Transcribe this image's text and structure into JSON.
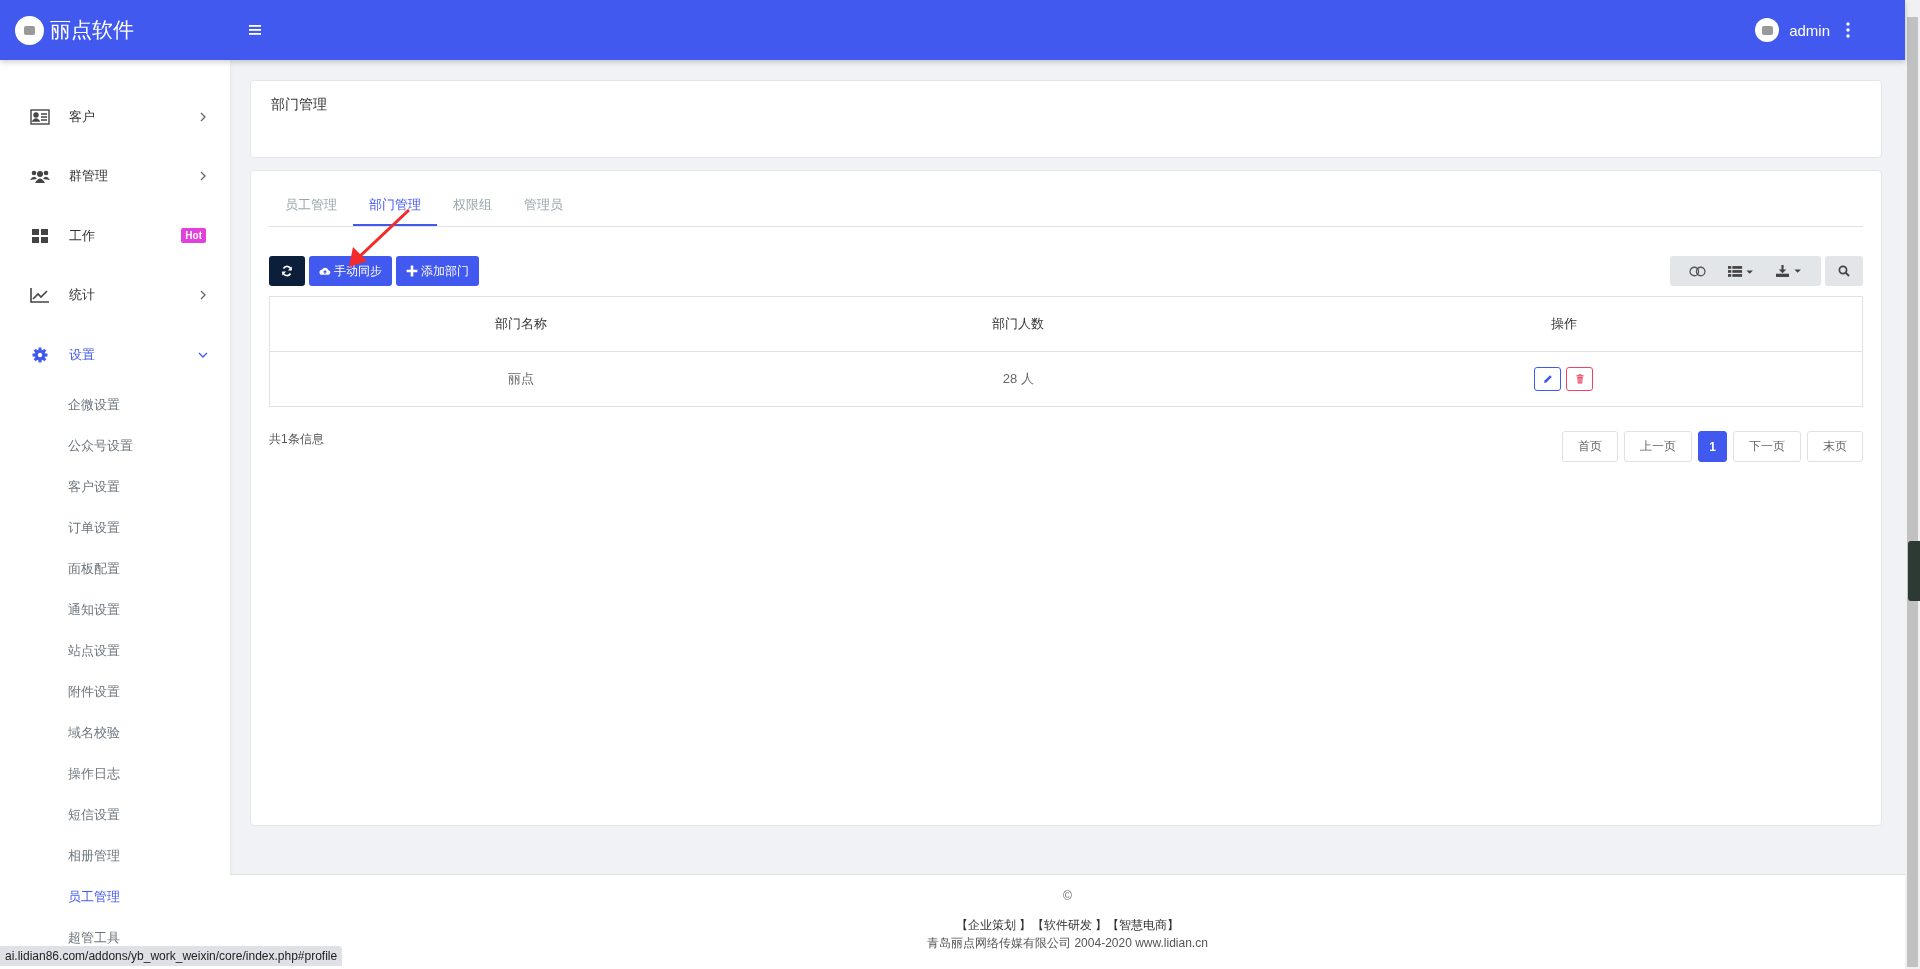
{
  "brand": {
    "name": "丽点软件"
  },
  "user": {
    "name": "admin"
  },
  "sidebar": {
    "items": [
      {
        "label": "客户",
        "kind": "submenu",
        "selected": false,
        "expanded": false
      },
      {
        "label": "群管理",
        "kind": "submenu",
        "selected": false,
        "expanded": false
      },
      {
        "label": "工作",
        "kind": "badge",
        "badge": "Hot",
        "selected": false
      },
      {
        "label": "统计",
        "kind": "submenu",
        "selected": false,
        "expanded": false
      },
      {
        "label": "设置",
        "kind": "submenu",
        "selected": true,
        "expanded": true,
        "children": [
          {
            "label": "企微设置",
            "selected": false
          },
          {
            "label": "公众号设置",
            "selected": false
          },
          {
            "label": "客户设置",
            "selected": false
          },
          {
            "label": "订单设置",
            "selected": false
          },
          {
            "label": "面板配置",
            "selected": false
          },
          {
            "label": "通知设置",
            "selected": false
          },
          {
            "label": "站点设置",
            "selected": false
          },
          {
            "label": "附件设置",
            "selected": false
          },
          {
            "label": "域名校验",
            "selected": false
          },
          {
            "label": "操作日志",
            "selected": false
          },
          {
            "label": "短信设置",
            "selected": false
          },
          {
            "label": "相册管理",
            "selected": false
          },
          {
            "label": "员工管理",
            "selected": true
          },
          {
            "label": "超管工具",
            "selected": false
          }
        ]
      }
    ]
  },
  "page_header": {
    "title": "部门管理"
  },
  "tabs": [
    {
      "label": "员工管理",
      "selected": false
    },
    {
      "label": "部门管理",
      "selected": true
    },
    {
      "label": "权限组",
      "selected": false
    },
    {
      "label": "管理员",
      "selected": false
    }
  ],
  "toolbar": {
    "buttons": [
      {
        "label": "手动同步"
      },
      {
        "label": "添加部门"
      }
    ]
  },
  "table": {
    "columns": [
      "部门名称",
      "部门人数",
      "操作"
    ],
    "rows": [
      {
        "cells": [
          "丽点",
          "28 人"
        ]
      }
    ]
  },
  "total": "共1条信息",
  "pagination": [
    {
      "label": "首页",
      "selected": false
    },
    {
      "label": "上一页",
      "selected": false
    },
    {
      "label": "1",
      "selected": true
    },
    {
      "label": "下一页",
      "selected": false
    },
    {
      "label": "末页",
      "selected": false
    }
  ],
  "footer": {
    "symbol": "©",
    "links": [
      "【企业策划 】",
      "【软件研发 】",
      "【智慧电商】"
    ],
    "company": "青岛丽点网络传媒有限公司 2004-2020 www.lidian.cn"
  },
  "status_url": "ai.lidian86.com/addons/yb_work_weixin/core/index.php#profile"
}
